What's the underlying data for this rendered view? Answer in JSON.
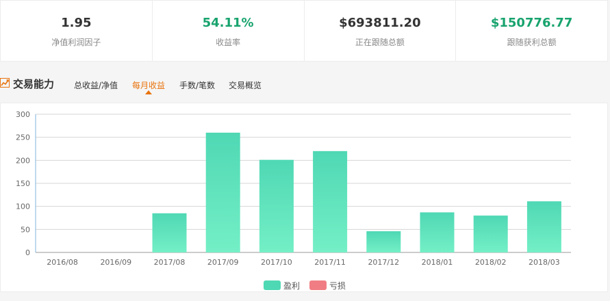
{
  "stats": [
    {
      "value": "1.95",
      "label": "净值利润因子",
      "accent": false
    },
    {
      "value": "54.11%",
      "label": "收益率",
      "accent": true
    },
    {
      "value": "$693811.20",
      "label": "正在跟随总额",
      "accent": false
    },
    {
      "value": "$150776.77",
      "label": "跟随获利总额",
      "accent": true
    }
  ],
  "section": {
    "title": "交易能力",
    "icon": "trend-chart-icon",
    "tabs": [
      {
        "label": "总收益/净值",
        "active": false
      },
      {
        "label": "每月收益",
        "active": true
      },
      {
        "label": "手数/笔数",
        "active": false
      },
      {
        "label": "交易概览",
        "active": false
      }
    ]
  },
  "colors": {
    "profit_top": "#4fd8b4",
    "profit_bottom": "#74efc6",
    "loss": "#f07d83",
    "accent_orange": "#e8720c",
    "accent_green": "#18a36e"
  },
  "chart_data": {
    "type": "bar",
    "categories": [
      "2016/08",
      "2016/09",
      "2017/08",
      "2017/09",
      "2017/10",
      "2017/11",
      "2017/12",
      "2018/01",
      "2018/02",
      "2018/03"
    ],
    "series": [
      {
        "name": "盈利",
        "values": [
          0,
          0,
          85,
          260,
          201,
          220,
          46,
          87,
          80,
          111
        ]
      },
      {
        "name": "亏损",
        "values": [
          0,
          0,
          0,
          0,
          0,
          0,
          0,
          0,
          0,
          0
        ]
      }
    ],
    "ylim": [
      0,
      300
    ],
    "yticks": [
      0,
      50,
      100,
      150,
      200,
      250,
      300
    ],
    "grid": true,
    "legend": "bottom-center"
  }
}
